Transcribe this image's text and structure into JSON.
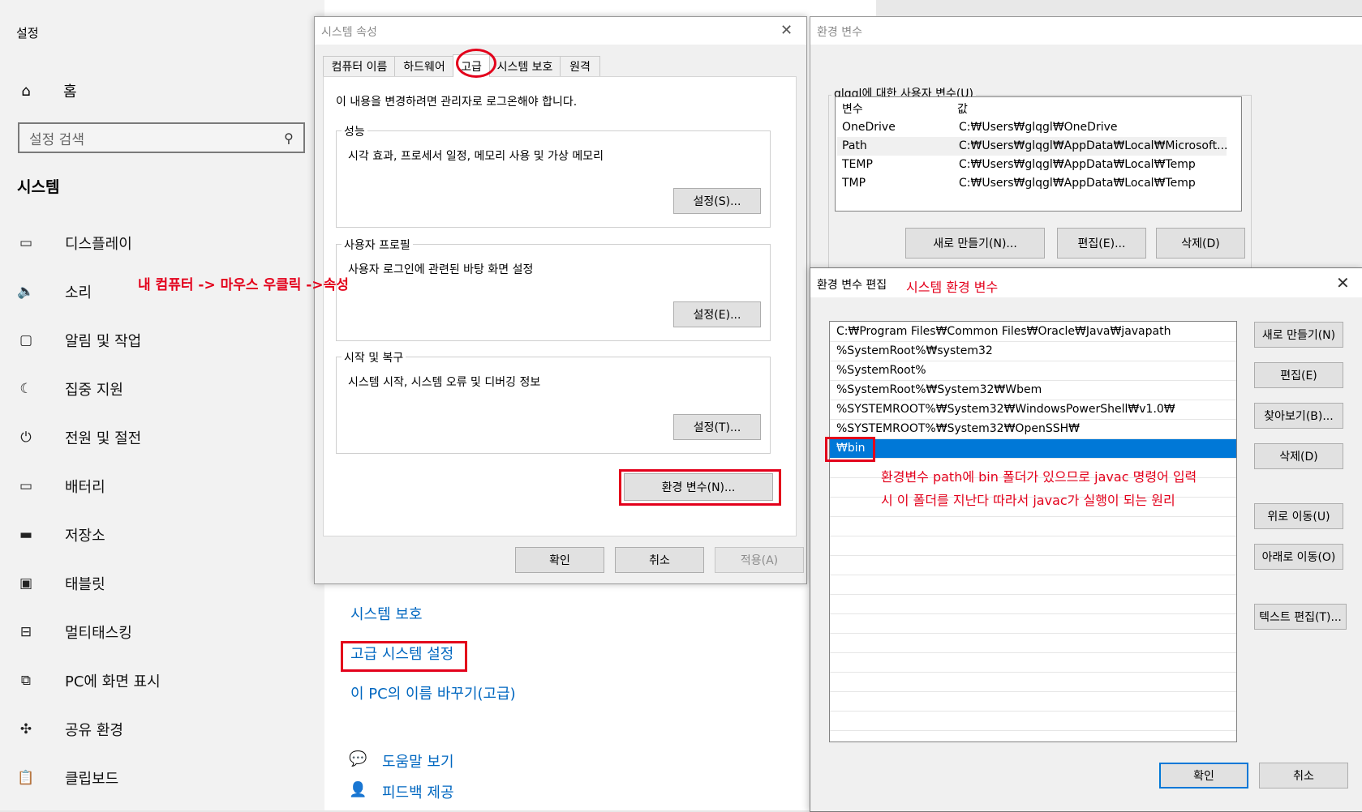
{
  "settings": {
    "title": "설정",
    "home_label": "홈",
    "search_placeholder": "설정 검색",
    "section_heading": "시스템",
    "nav": [
      {
        "label": "디스플레이",
        "icon": "monitor-icon"
      },
      {
        "label": "소리",
        "icon": "speaker-icon"
      },
      {
        "label": "알림 및 작업",
        "icon": "notification-icon"
      },
      {
        "label": "집중 지원",
        "icon": "moon-icon"
      },
      {
        "label": "전원 및 절전",
        "icon": "power-icon"
      },
      {
        "label": "배터리",
        "icon": "battery-icon"
      },
      {
        "label": "저장소",
        "icon": "storage-icon"
      },
      {
        "label": "태블릿",
        "icon": "tablet-icon"
      },
      {
        "label": "멀티태스킹",
        "icon": "multitasking-icon"
      },
      {
        "label": "PC에 화면 표시",
        "icon": "project-icon"
      },
      {
        "label": "공유 환경",
        "icon": "share-icon"
      },
      {
        "label": "클립보드",
        "icon": "clipboard-icon"
      }
    ],
    "links": {
      "system_protection": "시스템 보호",
      "advanced_settings": "고급 시스템 설정",
      "rename_pc": "이 PC의 이름 바꾸기(고급)",
      "help": "도움말 보기",
      "feedback": "피드백 제공"
    },
    "annotation": "내 컴퓨터 -> 마우스 우클릭 ->속성"
  },
  "system_properties": {
    "title": "시스템 속성",
    "tabs": [
      "컴퓨터 이름",
      "하드웨어",
      "고급",
      "시스템 보호",
      "원격"
    ],
    "active_tab": "고급",
    "admin_note": "이 내용을 변경하려면 관리자로 로그온해야 합니다.",
    "groups": [
      {
        "label": "성능",
        "desc": "시각 효과, 프로세서 일정, 메모리 사용 및 가상 메모리",
        "button": "설정(S)..."
      },
      {
        "label": "사용자 프로필",
        "desc": "사용자 로그인에 관련된 바탕 화면 설정",
        "button": "설정(E)..."
      },
      {
        "label": "시작 및 복구",
        "desc": "시스템 시작, 시스템 오류 및 디버깅 정보",
        "button": "설정(T)..."
      }
    ],
    "env_button": "환경 변수(N)...",
    "ok": "확인",
    "cancel": "취소",
    "apply": "적용(A)"
  },
  "env_vars": {
    "title": "환경 변수",
    "user_group_label": "glqgl에 대한 사용자 변수(U)",
    "col_var": "변수",
    "col_val": "값",
    "rows": [
      {
        "name": "OneDrive",
        "value": "C:₩Users₩glqgl₩OneDrive"
      },
      {
        "name": "Path",
        "value": "C:₩Users₩glqgl₩AppData₩Local₩Microsoft..."
      },
      {
        "name": "TEMP",
        "value": "C:₩Users₩glqgl₩AppData₩Local₩Temp"
      },
      {
        "name": "TMP",
        "value": "C:₩Users₩glqgl₩AppData₩Local₩Temp"
      }
    ],
    "new_button": "새로 만들기(N)...",
    "edit_button": "편집(E)...",
    "delete_button": "삭제(D)"
  },
  "edit_env": {
    "title": "환경 변수 편집",
    "annotation": "시스템 환경 변수",
    "paths": [
      "C:₩Program Files₩Common Files₩Oracle₩Java₩javapath",
      "%SystemRoot%₩system32",
      "%SystemRoot%",
      "%SystemRoot%₩System32₩Wbem",
      "%SYSTEMROOT%₩System32₩WindowsPowerShell₩v1.0₩",
      "%SYSTEMROOT%₩System32₩OpenSSH₩",
      "₩bin"
    ],
    "explanation_line1": "환경변수 path에 bin 폴더가 있으므로 javac 명령어 입력",
    "explanation_line2": "시 이 폴더를 지난다 따라서 javac가 실행이 되는 원리",
    "buttons": {
      "new": "새로 만들기(N)",
      "edit": "편집(E)",
      "browse": "찾아보기(B)...",
      "delete": "삭제(D)",
      "move_up": "위로 이동(U)",
      "move_down": "아래로 이동(O)",
      "edit_text": "텍스트 편집(T)..."
    },
    "ok": "확인",
    "cancel": "취소"
  },
  "colors": {
    "accent": "#0078d7",
    "link": "#0067c0",
    "annotation_red": "#e3001b"
  }
}
